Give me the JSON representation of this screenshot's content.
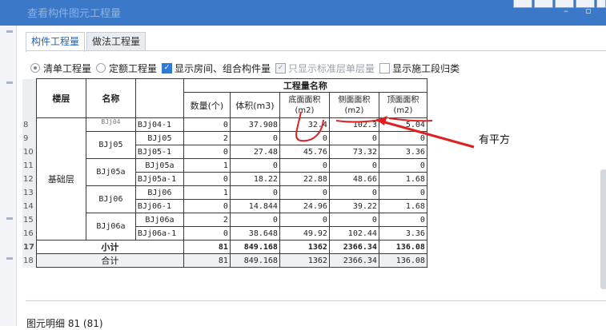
{
  "window": {
    "title": "查看构件图元工程量"
  },
  "tabs": [
    {
      "label": "构件工程量",
      "active": true
    },
    {
      "label": "做法工程量",
      "active": false
    }
  ],
  "options": {
    "radio_list": "清单工程量",
    "radio_quota": "定额工程量",
    "chk_show_rooms": "显示房间、组合构件量",
    "chk_std_only": "只显示标准层单层量",
    "chk_segment": "显示施工段归类"
  },
  "table": {
    "group_header": "工程量名称",
    "col_floor": "楼层",
    "col_name": "名称",
    "col_qty": "数量(个)",
    "col_vol": "体积(m3)",
    "col_bottom": "底面面积(m2)",
    "col_side": "侧面面积(m2)",
    "col_top": "顶面面积(m2)",
    "floor_label": "基础层",
    "top_name_fragment": "BJj04",
    "rows": [
      {
        "rn": "8",
        "sub": "BJj04-1",
        "qty": "0",
        "vol": "37.908",
        "bottom": "32.4",
        "side": "102.3",
        "top": "5.04"
      },
      {
        "rn": "9",
        "sub": "BJj05",
        "qty": "2",
        "vol": "0",
        "bottom": "0",
        "side": "0",
        "top": "0"
      },
      {
        "rn": "10",
        "sub": "BJj05-1",
        "qty": "0",
        "vol": "27.48",
        "bottom": "45.76",
        "side": "73.32",
        "top": "3.36"
      },
      {
        "rn": "11",
        "sub": "BJj05a",
        "qty": "1",
        "vol": "0",
        "bottom": "0",
        "side": "0",
        "top": "0"
      },
      {
        "rn": "12",
        "sub": "BJj05a-1",
        "qty": "0",
        "vol": "18.22",
        "bottom": "22.88",
        "side": "48.66",
        "top": "1.68"
      },
      {
        "rn": "13",
        "sub": "BJj06",
        "qty": "1",
        "vol": "0",
        "bottom": "0",
        "side": "0",
        "top": "0"
      },
      {
        "rn": "14",
        "sub": "BJj06-1",
        "qty": "0",
        "vol": "14.844",
        "bottom": "24.96",
        "side": "39.22",
        "top": "1.68"
      },
      {
        "rn": "15",
        "sub": "BJj06a",
        "qty": "2",
        "vol": "0",
        "bottom": "0",
        "side": "0",
        "top": "0"
      },
      {
        "rn": "16",
        "sub": "BJj06a-1",
        "qty": "0",
        "vol": "38.648",
        "bottom": "49.92",
        "side": "102.44",
        "top": "3.36"
      }
    ],
    "groups": [
      "BJj05",
      "BJj05a",
      "BJj06",
      "BJj06a"
    ],
    "subtotal": {
      "rn": "17",
      "label": "小计",
      "qty": "81",
      "vol": "849.168",
      "bottom": "1362",
      "side": "2366.34",
      "top": "136.08"
    },
    "total": {
      "rn": "18",
      "label": "合计",
      "qty": "81",
      "vol": "849.168",
      "bottom": "1362",
      "side": "2366.34",
      "top": "136.08"
    }
  },
  "annotation": "有平方",
  "status": "图元明细 81 (81)",
  "colors": {
    "titlebar": "#3b78c8",
    "accent": "#1f5fb4",
    "annotation_ink": "#e02020"
  }
}
